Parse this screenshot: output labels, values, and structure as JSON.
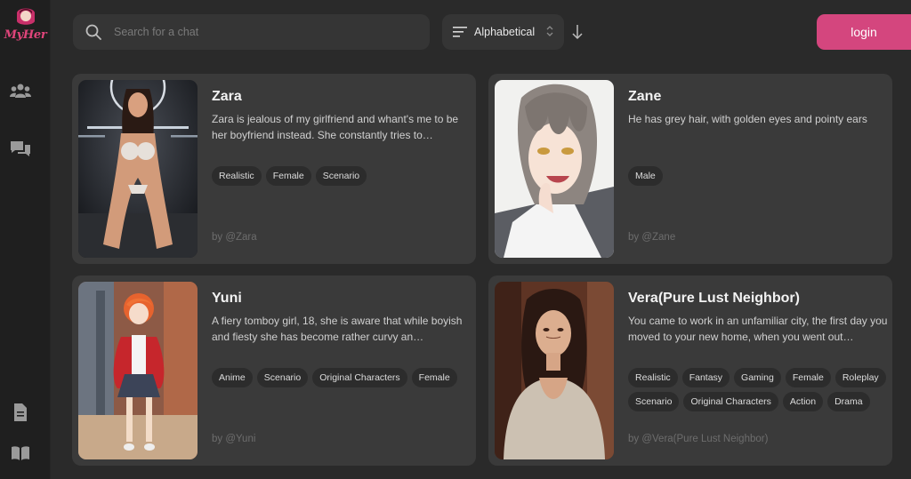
{
  "brand": {
    "name": "MyHer",
    "accent": "#d4467e"
  },
  "sidebar": {
    "items": [
      {
        "icon": "users-icon"
      },
      {
        "icon": "chat-bubbles-icon"
      },
      {
        "icon": "document-icon"
      },
      {
        "icon": "book-icon"
      }
    ]
  },
  "search": {
    "placeholder": "Search for a chat",
    "value": ""
  },
  "sort": {
    "label": "Alphabetical",
    "direction_icon": "arrow-down-icon"
  },
  "login": {
    "label": "login"
  },
  "cards": [
    {
      "name": "Zara",
      "description": "Zara is jealous of my girlfriend and whant's me to be her boyfriend instead. She constantly tries to…",
      "tags": [
        "Realistic",
        "Female",
        "Scenario"
      ],
      "author": "by @Zara"
    },
    {
      "name": "Zane",
      "description": "He has grey hair, with golden eyes and pointy ears",
      "tags": [
        "Male"
      ],
      "author": "by @Zane"
    },
    {
      "name": "Yuni",
      "description": "A fiery tomboy girl, 18, she is aware that while boyish and fiesty she has become rather curvy an…",
      "tags": [
        "Anime",
        "Scenario",
        "Original Characters",
        "Female"
      ],
      "author": "by @Yuni"
    },
    {
      "name": "Vera(Pure Lust Neighbor)",
      "description": "You came to work in an unfamiliar city, the first day you moved to your new home, when you went out…",
      "tags": [
        "Realistic",
        "Fantasy",
        "Gaming",
        "Female",
        "Roleplay",
        "Scenario",
        "Original Characters",
        "Action",
        "Drama"
      ],
      "author": "by @Vera(Pure Lust Neighbor)"
    }
  ]
}
